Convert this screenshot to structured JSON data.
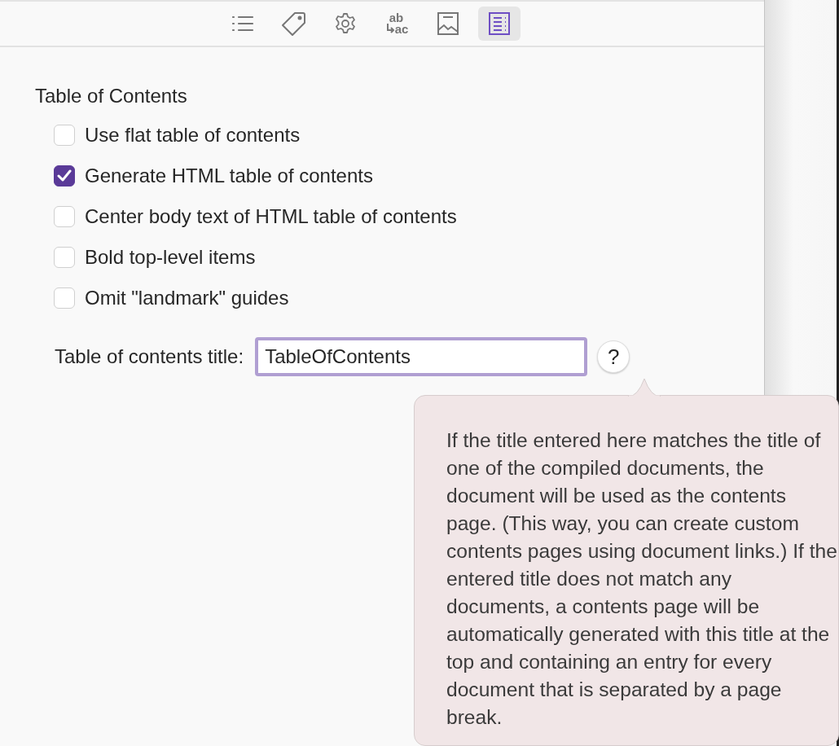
{
  "toolbar": [
    {
      "kind": "list",
      "selected": false
    },
    {
      "kind": "tag",
      "selected": false
    },
    {
      "kind": "gear",
      "selected": false
    },
    {
      "kind": "replace",
      "top": "ab",
      "bottom": "ac",
      "selected": false
    },
    {
      "kind": "image",
      "selected": false
    },
    {
      "kind": "document",
      "selected": true
    }
  ],
  "section_title": "Table of Contents",
  "options": [
    {
      "label": "Use flat table of contents",
      "checked": false
    },
    {
      "label": "Generate HTML table of contents",
      "checked": true
    },
    {
      "label": "Center body text of HTML table of contents",
      "checked": false
    },
    {
      "label": "Bold top-level items",
      "checked": false
    },
    {
      "label": "Omit \"landmark\" guides",
      "checked": false
    }
  ],
  "title_field": {
    "label": "Table of contents title:",
    "value": "TableOfContents"
  },
  "help_button": "?",
  "popover": {
    "text": "If the title entered here matches the title of one of the compiled documents, the document will be used as the contents page. (This way, you can create custom contents pages using document links.) If the entered title does not match any documents, a contents page will be automatically generated with this title at the top and containing an entry for every document that is separated by a page break."
  }
}
